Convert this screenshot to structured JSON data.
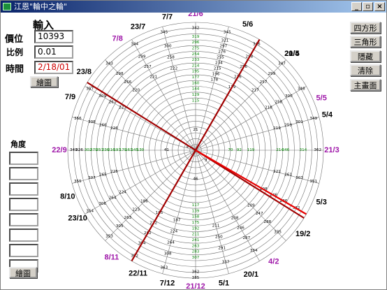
{
  "window": {
    "title": "江恩\"輪中之輪\"",
    "minimize": "_",
    "maximize": "▫",
    "close": "×"
  },
  "input_panel": {
    "heading": "輸入",
    "price_label": "價位",
    "price_value": "10393",
    "ratio_label": "比例",
    "ratio_value": "0.01",
    "time_label": "時間",
    "time_value": "2/18/01",
    "draw_button": "繪圖"
  },
  "angle_panel": {
    "heading": "角度",
    "fields": [
      "",
      "",
      "",
      "",
      "",
      "",
      "",
      ""
    ],
    "draw_button": "繪圖"
  },
  "right_buttons": [
    "四方形",
    "三角形",
    "隱藏",
    "清除",
    "主畫面"
  ],
  "dates": [
    {
      "label": "21/6",
      "angle": 270,
      "color": "#9e16a8"
    },
    {
      "label": "5/6",
      "angle": 292.5,
      "color": "#000000"
    },
    {
      "label": "21/5",
      "angle": 315,
      "color": "#000000"
    },
    {
      "label": "5/5",
      "angle": 337.5,
      "color": "#9e16a8"
    },
    {
      "label": "20/4",
      "angle": 315,
      "color": "#000000"
    },
    {
      "label": "5/4",
      "angle": 345,
      "color": "#000000"
    },
    {
      "label": "21/3",
      "angle": 0,
      "color": "#9e16a8"
    },
    {
      "label": "5/3",
      "angle": 22.5,
      "color": "#000000"
    },
    {
      "label": "19/2",
      "angle": 38,
      "color": "#000000"
    },
    {
      "label": "4/2",
      "angle": 55,
      "color": "#9e16a8"
    },
    {
      "label": "20/1",
      "angle": 66,
      "color": "#000000"
    },
    {
      "label": "5/1",
      "angle": 78,
      "color": "#000000"
    },
    {
      "label": "21/12",
      "angle": 90,
      "color": "#9e16a8"
    },
    {
      "label": "7/12",
      "angle": 102,
      "color": "#000000"
    },
    {
      "label": "22/11",
      "angle": 115,
      "color": "#000000"
    },
    {
      "label": "8/11",
      "angle": 128,
      "color": "#9e16a8"
    },
    {
      "label": "23/10",
      "angle": 150,
      "color": "#000000"
    },
    {
      "label": "8/10",
      "angle": 160,
      "color": "#000000"
    },
    {
      "label": "22/9",
      "angle": 180,
      "color": "#9e16a8"
    },
    {
      "label": "7/9",
      "angle": 203,
      "color": "#000000"
    },
    {
      "label": "23/8",
      "angle": 215,
      "color": "#000000"
    },
    {
      "label": "7/8",
      "angle": 235,
      "color": "#9e16a8"
    },
    {
      "label": "23/7",
      "angle": 245,
      "color": "#000000"
    },
    {
      "label": "7/7",
      "angle": 258,
      "color": "#000000"
    }
  ],
  "rays": [
    {
      "name": "ray-23-8-to-19-2",
      "angle": 212,
      "color": "#a10000"
    },
    {
      "name": "ray-21-5-to-22-11",
      "angle": 300,
      "color": "#a10000"
    },
    {
      "name": "ray-center-to-19-2",
      "angle": 30,
      "color": "#e80000"
    }
  ],
  "wheel": {
    "rings": 22,
    "spokes": 24,
    "cells": [
      {
        "v": 342,
        "a": 270,
        "r": 21
      },
      {
        "v": 319,
        "a": 270,
        "r": 19.5
      },
      {
        "v": 296,
        "a": 270,
        "r": 18.5
      },
      {
        "v": 275,
        "a": 270,
        "r": 17.5
      },
      {
        "v": 254,
        "a": 270,
        "r": 16.5
      },
      {
        "v": 233,
        "a": 270,
        "r": 15.5
      },
      {
        "v": 214,
        "a": 270,
        "r": 14.5
      },
      {
        "v": 195,
        "a": 270,
        "r": 13.5
      },
      {
        "v": 177,
        "a": 270,
        "r": 12.5
      },
      {
        "v": 160,
        "a": 270,
        "r": 11.5
      },
      {
        "v": 144,
        "a": 270,
        "r": 10.5
      },
      {
        "v": 129,
        "a": 270,
        "r": 9.5
      },
      {
        "v": 115,
        "a": 270,
        "r": 8.5
      },
      {
        "v": 345,
        "a": 285,
        "r": 21
      },
      {
        "v": 321,
        "a": 285,
        "r": 19.5
      },
      {
        "v": 297,
        "a": 285,
        "r": 18.5
      },
      {
        "v": 276,
        "a": 285,
        "r": 17.5
      },
      {
        "v": 255,
        "a": 285,
        "r": 16.5
      },
      {
        "v": 234,
        "a": 285,
        "r": 15.5
      },
      {
        "v": 215,
        "a": 285,
        "r": 14.5
      },
      {
        "v": 196,
        "a": 285,
        "r": 13.5
      },
      {
        "v": 178,
        "a": 285,
        "r": 12.5
      },
      {
        "v": 346,
        "a": 300,
        "r": 21
      },
      {
        "v": 298,
        "a": 300,
        "r": 18.5
      },
      {
        "v": 256,
        "a": 300,
        "r": 16.5
      },
      {
        "v": 216,
        "a": 300,
        "r": 14.5
      },
      {
        "v": 179,
        "a": 300,
        "r": 12.5
      },
      {
        "v": 347,
        "a": 315,
        "r": 21
      },
      {
        "v": 299,
        "a": 315,
        "r": 18.5
      },
      {
        "v": 257,
        "a": 315,
        "r": 16.5
      },
      {
        "v": 217,
        "a": 315,
        "r": 14.5
      },
      {
        "v": 348,
        "a": 330,
        "r": 21
      },
      {
        "v": 300,
        "a": 330,
        "r": 18.5
      },
      {
        "v": 258,
        "a": 330,
        "r": 16.5
      },
      {
        "v": 218,
        "a": 330,
        "r": 14.5
      },
      {
        "v": 349,
        "a": 345,
        "r": 21
      },
      {
        "v": 301,
        "a": 345,
        "r": 18.5
      },
      {
        "v": 259,
        "a": 345,
        "r": 16.5
      },
      {
        "v": 219,
        "a": 345,
        "r": 14.5
      },
      {
        "v": 362,
        "a": 0,
        "r": 21
      },
      {
        "v": 314,
        "a": 0,
        "r": 18.5
      },
      {
        "v": 246,
        "a": 0,
        "r": 15.5
      },
      {
        "v": 214,
        "a": 0,
        "r": 14.5
      },
      {
        "v": 119,
        "a": 0,
        "r": 9.5
      },
      {
        "v": 92,
        "a": 0,
        "r": 7.5
      },
      {
        "v": 351,
        "a": 15,
        "r": 21
      },
      {
        "v": 303,
        "a": 15,
        "r": 18.5
      },
      {
        "v": 261,
        "a": 15,
        "r": 16.5
      },
      {
        "v": 221,
        "a": 15,
        "r": 14.5
      },
      {
        "v": 332,
        "a": 30,
        "r": 20
      },
      {
        "v": 286,
        "a": 30,
        "r": 17.5
      },
      {
        "v": 246,
        "a": 30,
        "r": 15.5
      },
      {
        "v": 208,
        "a": 30,
        "r": 13.5
      },
      {
        "v": 335,
        "a": 45,
        "r": 20
      },
      {
        "v": 288,
        "a": 45,
        "r": 17.5
      },
      {
        "v": 247,
        "a": 45,
        "r": 15.5
      },
      {
        "v": 209,
        "a": 45,
        "r": 13.5
      },
      {
        "v": 334,
        "a": 60,
        "r": 20
      },
      {
        "v": 287,
        "a": 60,
        "r": 17.5
      },
      {
        "v": 246,
        "a": 60,
        "r": 15.5
      },
      {
        "v": 208,
        "a": 60,
        "r": 13.5
      },
      {
        "v": 337,
        "a": 75,
        "r": 20
      },
      {
        "v": 291,
        "a": 75,
        "r": 17.5
      },
      {
        "v": 250,
        "a": 75,
        "r": 15.5
      },
      {
        "v": 211,
        "a": 75,
        "r": 13.5
      },
      {
        "v": 385,
        "a": 90,
        "r": 22
      },
      {
        "v": 362,
        "a": 90,
        "r": 21
      },
      {
        "v": 307,
        "a": 90,
        "r": 18.5
      },
      {
        "v": 283,
        "a": 90,
        "r": 17.5
      },
      {
        "v": 263,
        "a": 90,
        "r": 16.5
      },
      {
        "v": 241,
        "a": 90,
        "r": 15.5
      },
      {
        "v": 211,
        "a": 90,
        "r": 14.5
      },
      {
        "v": 192,
        "a": 90,
        "r": 13.5
      },
      {
        "v": 175,
        "a": 90,
        "r": 12.5
      },
      {
        "v": 158,
        "a": 90,
        "r": 11.5
      },
      {
        "v": 139,
        "a": 90,
        "r": 10.5
      },
      {
        "v": 117,
        "a": 90,
        "r": 9.5
      },
      {
        "v": 363,
        "a": 105,
        "r": 21
      },
      {
        "v": 308,
        "a": 105,
        "r": 18.5
      },
      {
        "v": 264,
        "a": 105,
        "r": 16.5
      },
      {
        "v": 224,
        "a": 105,
        "r": 14.5
      },
      {
        "v": 187,
        "a": 105,
        "r": 12.5
      },
      {
        "v": 352,
        "a": 120,
        "r": 21
      },
      {
        "v": 304,
        "a": 120,
        "r": 18.5
      },
      {
        "v": 262,
        "a": 120,
        "r": 16.5
      },
      {
        "v": 222,
        "a": 120,
        "r": 14.5
      },
      {
        "v": 185,
        "a": 120,
        "r": 12.5
      },
      {
        "v": 353,
        "a": 135,
        "r": 21
      },
      {
        "v": 305,
        "a": 135,
        "r": 18.5
      },
      {
        "v": 263,
        "a": 135,
        "r": 16.5
      },
      {
        "v": 223,
        "a": 135,
        "r": 14.5
      },
      {
        "v": 186,
        "a": 135,
        "r": 12.5
      },
      {
        "v": 354,
        "a": 150,
        "r": 21
      },
      {
        "v": 306,
        "a": 150,
        "r": 18.5
      },
      {
        "v": 264,
        "a": 150,
        "r": 16.5
      },
      {
        "v": 224,
        "a": 150,
        "r": 14.5
      },
      {
        "v": 355,
        "a": 165,
        "r": 21
      },
      {
        "v": 307,
        "a": 165,
        "r": 18.5
      },
      {
        "v": 265,
        "a": 165,
        "r": 16.5
      },
      {
        "v": 225,
        "a": 165,
        "r": 14.5
      },
      {
        "v": 349,
        "a": 180,
        "r": 21
      },
      {
        "v": 326,
        "a": 180,
        "r": 20
      },
      {
        "v": 302,
        "a": 180,
        "r": 18.5
      },
      {
        "v": 279,
        "a": 180,
        "r": 17.5
      },
      {
        "v": 257,
        "a": 180,
        "r": 16.5
      },
      {
        "v": 236,
        "a": 180,
        "r": 15.5
      },
      {
        "v": 216,
        "a": 180,
        "r": 14.5
      },
      {
        "v": 197,
        "a": 180,
        "r": 13.5
      },
      {
        "v": 179,
        "a": 180,
        "r": 12.5
      },
      {
        "v": 161,
        "a": 180,
        "r": 11.5
      },
      {
        "v": 145,
        "a": 180,
        "r": 10.5
      },
      {
        "v": 130,
        "a": 180,
        "r": 9.5
      },
      {
        "v": 356,
        "a": 195,
        "r": 21
      },
      {
        "v": 308,
        "a": 195,
        "r": 18.5
      },
      {
        "v": 266,
        "a": 195,
        "r": 16.5
      },
      {
        "v": 226,
        "a": 195,
        "r": 14.5
      },
      {
        "v": 357,
        "a": 210,
        "r": 21
      },
      {
        "v": 309,
        "a": 210,
        "r": 18.5
      },
      {
        "v": 267,
        "a": 210,
        "r": 16.5
      },
      {
        "v": 227,
        "a": 210,
        "r": 14.5
      },
      {
        "v": 343,
        "a": 225,
        "r": 21
      },
      {
        "v": 298,
        "a": 225,
        "r": 18.5
      },
      {
        "v": 256,
        "a": 225,
        "r": 16.5
      },
      {
        "v": 220,
        "a": 225,
        "r": 14.5
      },
      {
        "v": 344,
        "a": 240,
        "r": 21
      },
      {
        "v": 299,
        "a": 240,
        "r": 18.5
      },
      {
        "v": 257,
        "a": 240,
        "r": 16.5
      },
      {
        "v": 221,
        "a": 240,
        "r": 14.5
      },
      {
        "v": 345,
        "a": 255,
        "r": 21
      },
      {
        "v": 300,
        "a": 255,
        "r": 18.5
      },
      {
        "v": 258,
        "a": 255,
        "r": 16.5
      },
      {
        "v": 222,
        "a": 255,
        "r": 14.5
      },
      {
        "v": 70,
        "a": 0,
        "r": 6
      },
      {
        "v": 46,
        "a": 90,
        "r": 5
      },
      {
        "v": 41,
        "a": 180,
        "r": 5
      },
      {
        "v": 21,
        "a": 270,
        "r": 3.5
      },
      {
        "v": 9,
        "a": 45,
        "r": 2.5
      },
      {
        "v": 4,
        "a": 200,
        "r": 1.5
      }
    ]
  }
}
